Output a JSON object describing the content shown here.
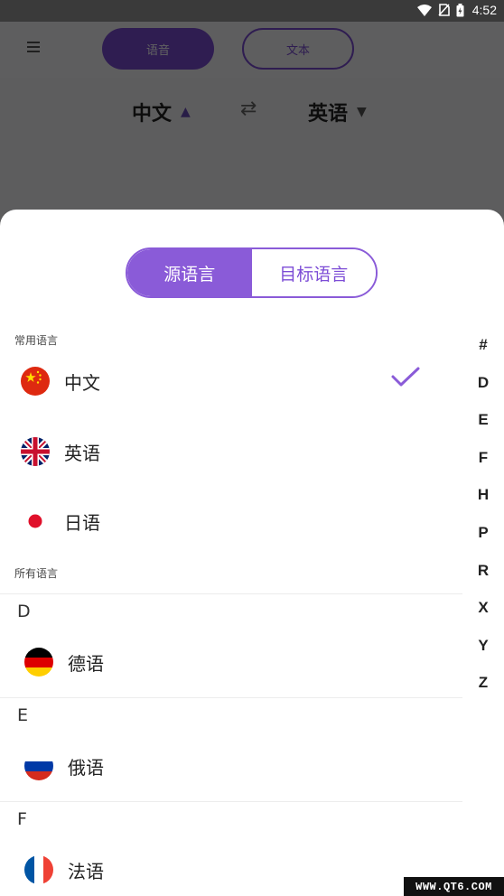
{
  "status_bar": {
    "time": "4:52"
  },
  "background_app": {
    "mode_tabs": [
      {
        "label": "语音"
      },
      {
        "label": "文本"
      }
    ],
    "source_language": "中文",
    "target_language": "英语"
  },
  "sheet": {
    "segments": [
      {
        "label": "源语言"
      },
      {
        "label": "目标语言"
      }
    ],
    "common_section_label": "常用语言",
    "common_languages": [
      {
        "name": "中文",
        "flag": "china-flag-icon",
        "selected": true
      },
      {
        "name": "英语",
        "flag": "uk-flag-icon",
        "selected": false
      },
      {
        "name": "日语",
        "flag": "japan-flag-icon",
        "selected": false
      }
    ],
    "all_section_label": "所有语言",
    "groups": [
      {
        "letter": "D",
        "languages": [
          {
            "name": "德语",
            "flag": "germany-flag-icon"
          }
        ]
      },
      {
        "letter": "E",
        "languages": [
          {
            "name": "俄语",
            "flag": "russia-flag-icon"
          }
        ]
      },
      {
        "letter": "F",
        "languages": [
          {
            "name": "法语",
            "flag": "france-flag-icon"
          }
        ]
      }
    ],
    "index_letters": [
      "#",
      "D",
      "E",
      "F",
      "H",
      "P",
      "R",
      "X",
      "Y",
      "Z"
    ]
  },
  "colors": {
    "accent": "#8a5bd8",
    "overlay": "#000000"
  },
  "watermark": "WWW.QT6.COM"
}
